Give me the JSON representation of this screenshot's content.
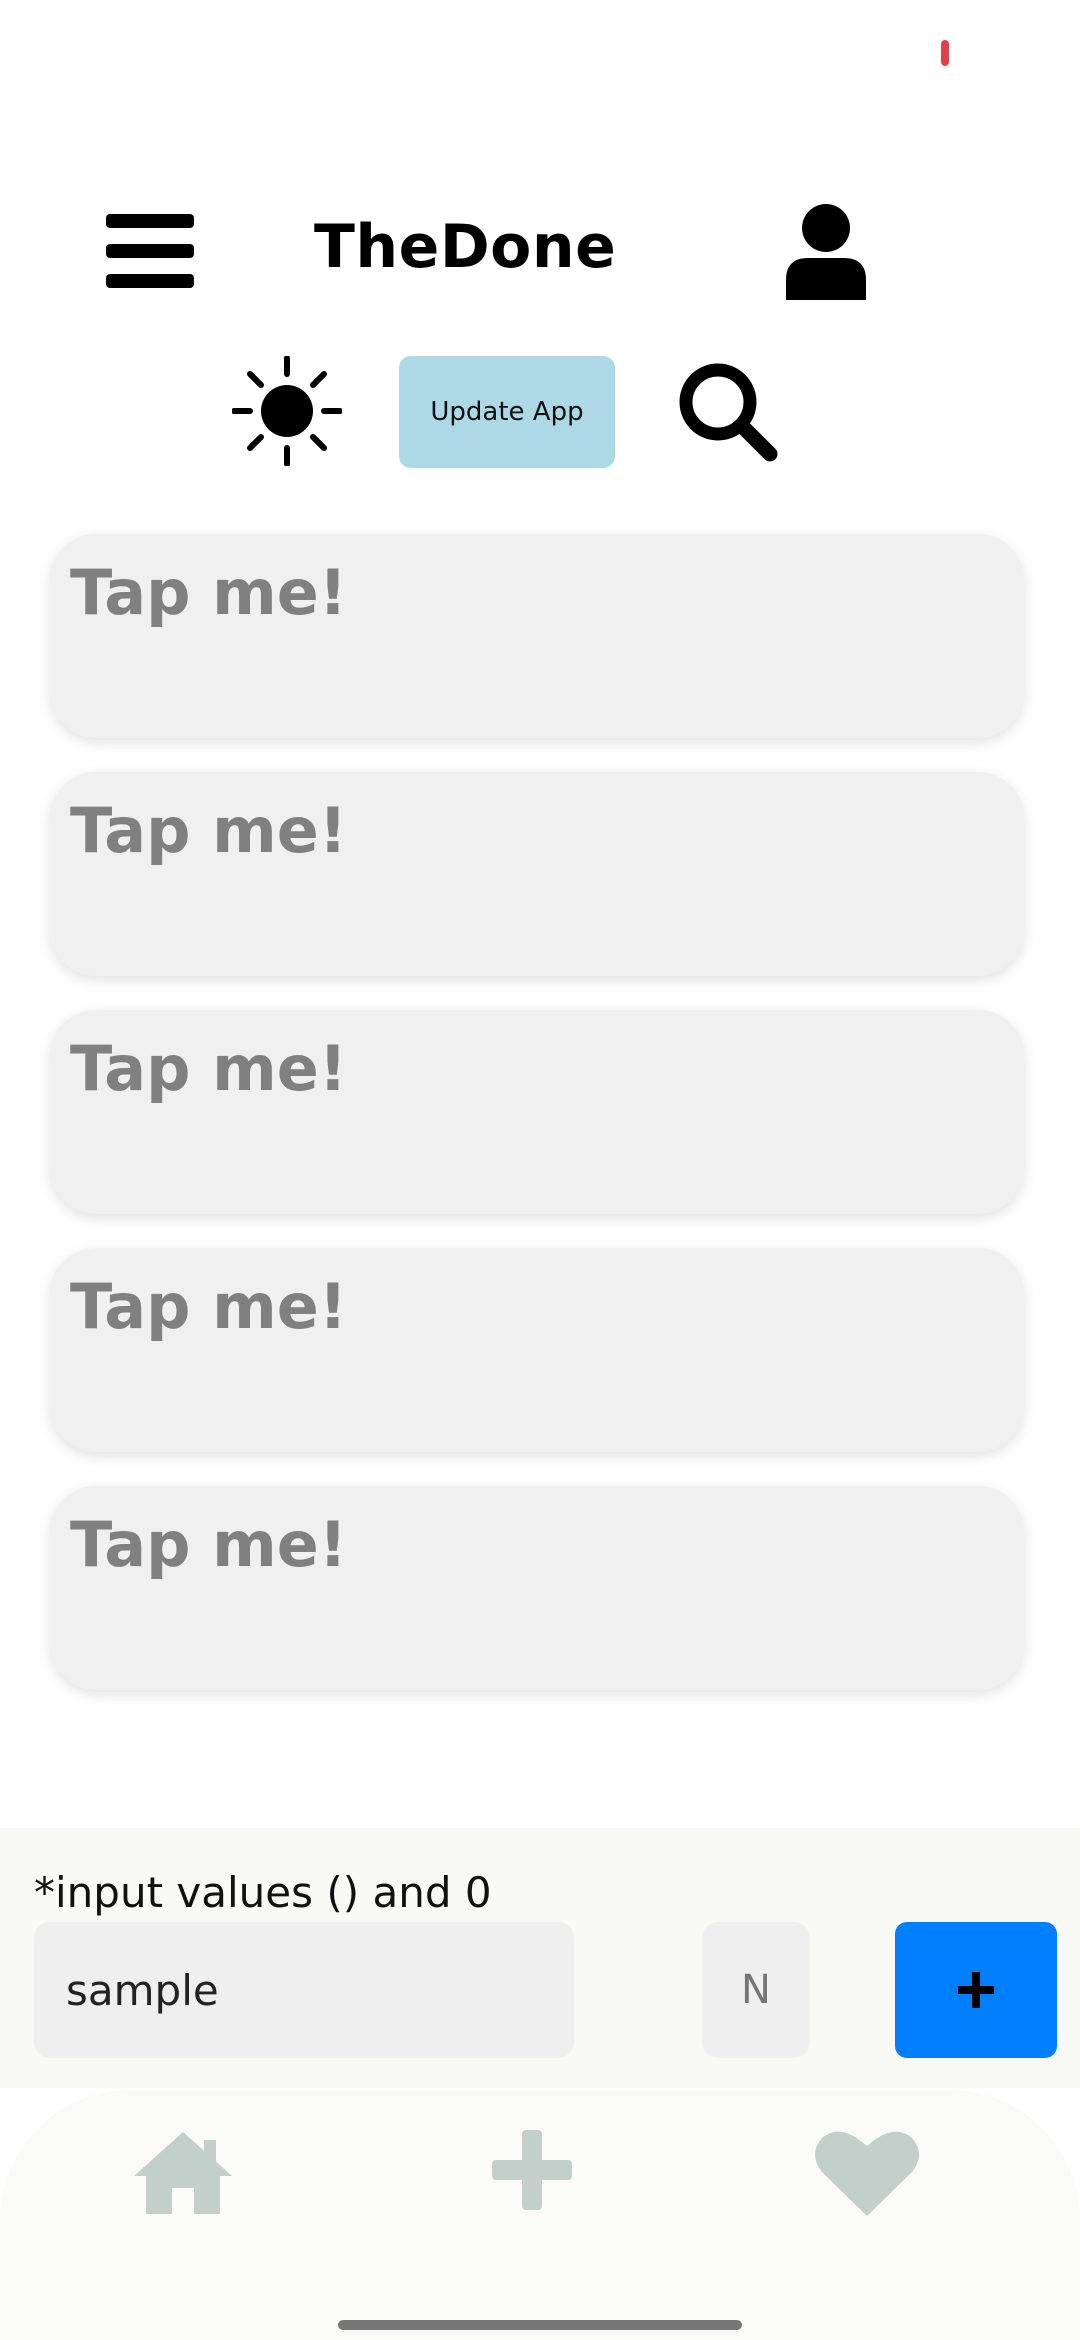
{
  "header": {
    "title": "TheDone",
    "menu_icon": "hamburger-menu-icon",
    "profile_icon": "user-profile-icon"
  },
  "toolbar": {
    "theme_icon": "sun-icon",
    "update_label": "Update App",
    "search_icon": "search-icon",
    "update_color": "#add8e6"
  },
  "cards": [
    {
      "label": "Tap me!"
    },
    {
      "label": "Tap me!"
    },
    {
      "label": "Tap me!"
    },
    {
      "label": "Tap me!"
    },
    {
      "label": "Tap me!"
    }
  ],
  "input_panel": {
    "hint": "*input values () and 0",
    "text_value": "sample",
    "n_placeholder": "N",
    "add_icon": "plus-icon",
    "add_color": "#0080ff"
  },
  "bottom_nav": {
    "items": [
      {
        "icon": "home-icon"
      },
      {
        "icon": "plus-icon"
      },
      {
        "icon": "heart-icon"
      }
    ],
    "icon_color": "#c3cfca"
  }
}
